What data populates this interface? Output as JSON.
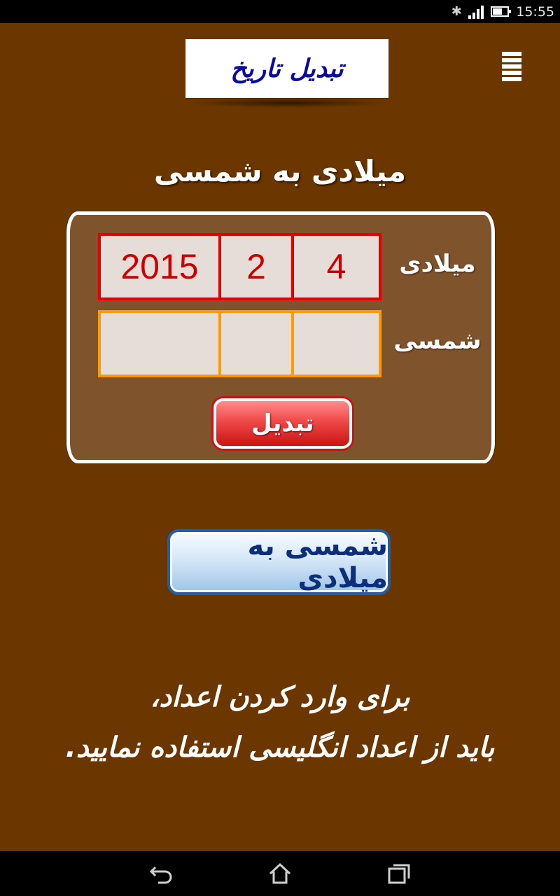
{
  "status_bar": {
    "time": "15:55",
    "icons": [
      "bluetooth-icon",
      "signal-icon",
      "battery-icon"
    ]
  },
  "header": {
    "title": "تبدیل تاریخ",
    "menu_icon": "hamburger-menu-icon"
  },
  "section_title": "میلادی به شمسی",
  "converter": {
    "gregorian": {
      "label": "میلادی",
      "year": "2015",
      "month": "2",
      "day": "4"
    },
    "persian": {
      "label": "شمسی",
      "year": "",
      "month": "",
      "day": ""
    },
    "convert_label": "تبدیل"
  },
  "switch_button_label": "شمسی به میلادی",
  "note": {
    "line1": "برای وارد کردن اعداد،",
    "line2": "باید از اعداد انگلیسی استفاده نمایید."
  },
  "nav_bar": {
    "icons": [
      "back-icon",
      "home-icon",
      "recents-icon"
    ]
  },
  "colors": {
    "background": "#6b3600",
    "panel": "#7f532c",
    "gregorian_border": "#e40000",
    "persian_border": "#ff9a00",
    "title_text": "#0a0aa0",
    "value_text": "#cc0000"
  }
}
